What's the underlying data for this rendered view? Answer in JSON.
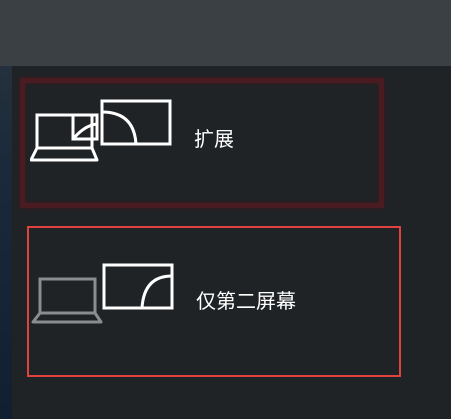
{
  "project_menu": {
    "options": [
      {
        "label": "扩展",
        "icon": "extend-display-icon"
      },
      {
        "label": "仅第二屏幕",
        "icon": "second-screen-only-icon"
      }
    ]
  },
  "colors": {
    "background": "#202326",
    "topbar": "#3b4045",
    "text": "#ffffff",
    "highlight_red": "#e0423f",
    "highlight_dark": "#4a1c22",
    "icon_active": "#ffffff",
    "icon_inactive": "#8a8d90"
  }
}
